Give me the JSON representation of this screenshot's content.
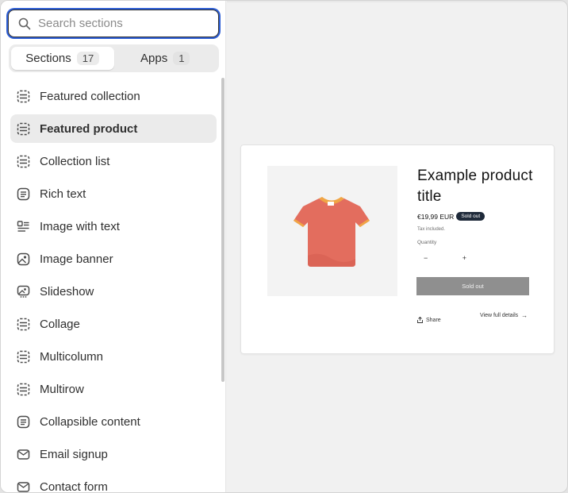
{
  "search": {
    "placeholder": "Search sections",
    "value": ""
  },
  "tabs": [
    {
      "label": "Sections",
      "count": "17",
      "active": true
    },
    {
      "label": "Apps",
      "count": "1",
      "active": false
    }
  ],
  "sections": [
    {
      "label": "Featured collection",
      "icon": "layout-section-icon",
      "selected": false
    },
    {
      "label": "Featured product",
      "icon": "layout-section-icon",
      "selected": true
    },
    {
      "label": "Collection list",
      "icon": "layout-section-icon",
      "selected": false
    },
    {
      "label": "Rich text",
      "icon": "text-block-icon",
      "selected": false
    },
    {
      "label": "Image with text",
      "icon": "image-with-text-icon",
      "selected": false
    },
    {
      "label": "Image banner",
      "icon": "image-icon",
      "selected": false
    },
    {
      "label": "Slideshow",
      "icon": "slideshow-icon",
      "selected": false
    },
    {
      "label": "Collage",
      "icon": "layout-section-icon",
      "selected": false
    },
    {
      "label": "Multicolumn",
      "icon": "layout-section-icon",
      "selected": false
    },
    {
      "label": "Multirow",
      "icon": "layout-section-icon",
      "selected": false
    },
    {
      "label": "Collapsible content",
      "icon": "text-block-icon",
      "selected": false
    },
    {
      "label": "Email signup",
      "icon": "email-icon",
      "selected": false
    },
    {
      "label": "Contact form",
      "icon": "email-icon",
      "selected": false
    }
  ],
  "preview": {
    "title": "Example product title",
    "price": "€19,99 EUR",
    "badge": "Sold out",
    "tax_note": "Tax included.",
    "quantity_label": "Quantity",
    "quantity_minus": "−",
    "quantity_plus": "+",
    "button_label": "Sold out",
    "share_label": "Share",
    "details_label": "View full details",
    "details_arrow": "→",
    "image_icon": "tshirt-icon"
  },
  "colors": {
    "focus_ring": "#2e5fd6",
    "tshirt_body": "#e36d5e",
    "tshirt_collar": "#f0a545",
    "badge_bg": "#1f2a3a",
    "sold_out_button": "#8f8f8f"
  }
}
